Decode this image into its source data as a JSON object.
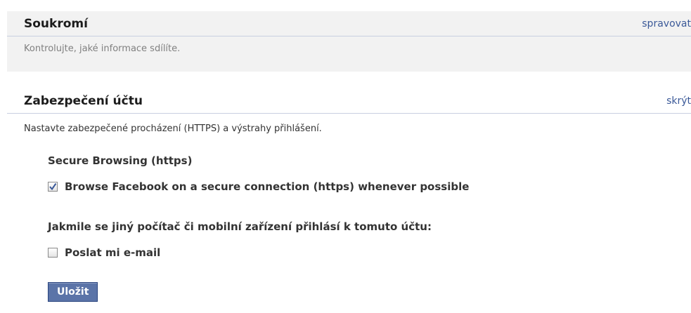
{
  "privacy": {
    "title": "Soukromí",
    "link": "spravovat",
    "description": "Kontrolujte, jaké informace sdílíte."
  },
  "security": {
    "title": "Zabezpečení účtu",
    "link": "skrýt",
    "description": "Nastavte zabezpečené procházení (HTTPS) a výstrahy přihlášení.",
    "secure_browsing": {
      "heading": "Secure Browsing (https)",
      "checkbox_label": "Browse Facebook on a secure connection (https) whenever possible",
      "checked": true
    },
    "login_alerts": {
      "heading": "Jakmile se jiný počítač či mobilní zařízení přihlásí k tomuto účtu:",
      "checkbox_label": "Poslat mi e-mail",
      "checked": false
    },
    "save_label": "Uložit"
  },
  "colors": {
    "link": "#3b5998",
    "button_bg": "#5b74a8",
    "checkmark": "#3b5998"
  }
}
